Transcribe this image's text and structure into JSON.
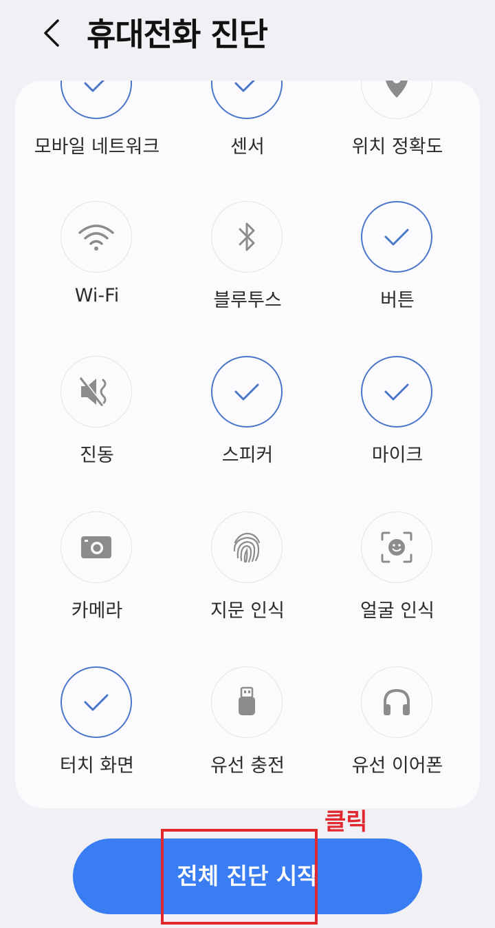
{
  "header": {
    "title": "휴대전화 진단",
    "back_icon": "chevron-left-icon"
  },
  "colors": {
    "accent": "#3a7df2",
    "check_ring": "#4a76c9",
    "icon_gray": "#8c8c8c",
    "annotation_red": "#e0282e"
  },
  "items": [
    {
      "label": "모바일 네트워크",
      "status": "checked",
      "icon": "check-icon"
    },
    {
      "label": "센서",
      "status": "checked",
      "icon": "check-icon"
    },
    {
      "label": "위치 정확도",
      "status": "pending",
      "icon": "location-pin-icon"
    },
    {
      "label": "Wi-Fi",
      "status": "pending",
      "icon": "wifi-icon"
    },
    {
      "label": "블루투스",
      "status": "pending",
      "icon": "bluetooth-icon"
    },
    {
      "label": "버튼",
      "status": "checked",
      "icon": "check-icon"
    },
    {
      "label": "진동",
      "status": "pending",
      "icon": "vibration-mute-icon"
    },
    {
      "label": "스피커",
      "status": "checked",
      "icon": "check-icon"
    },
    {
      "label": "마이크",
      "status": "checked",
      "icon": "check-icon"
    },
    {
      "label": "카메라",
      "status": "pending",
      "icon": "camera-icon"
    },
    {
      "label": "지문 인식",
      "status": "pending",
      "icon": "fingerprint-icon"
    },
    {
      "label": "얼굴 인식",
      "status": "pending",
      "icon": "face-scan-icon"
    },
    {
      "label": "터치 화면",
      "status": "checked",
      "icon": "check-icon"
    },
    {
      "label": "유선 충전",
      "status": "pending",
      "icon": "usb-plug-icon"
    },
    {
      "label": "유선 이어폰",
      "status": "pending",
      "icon": "headphones-icon"
    }
  ],
  "start_button": {
    "label": "전체 진단 시작"
  },
  "annotation": {
    "text": "클릭"
  }
}
